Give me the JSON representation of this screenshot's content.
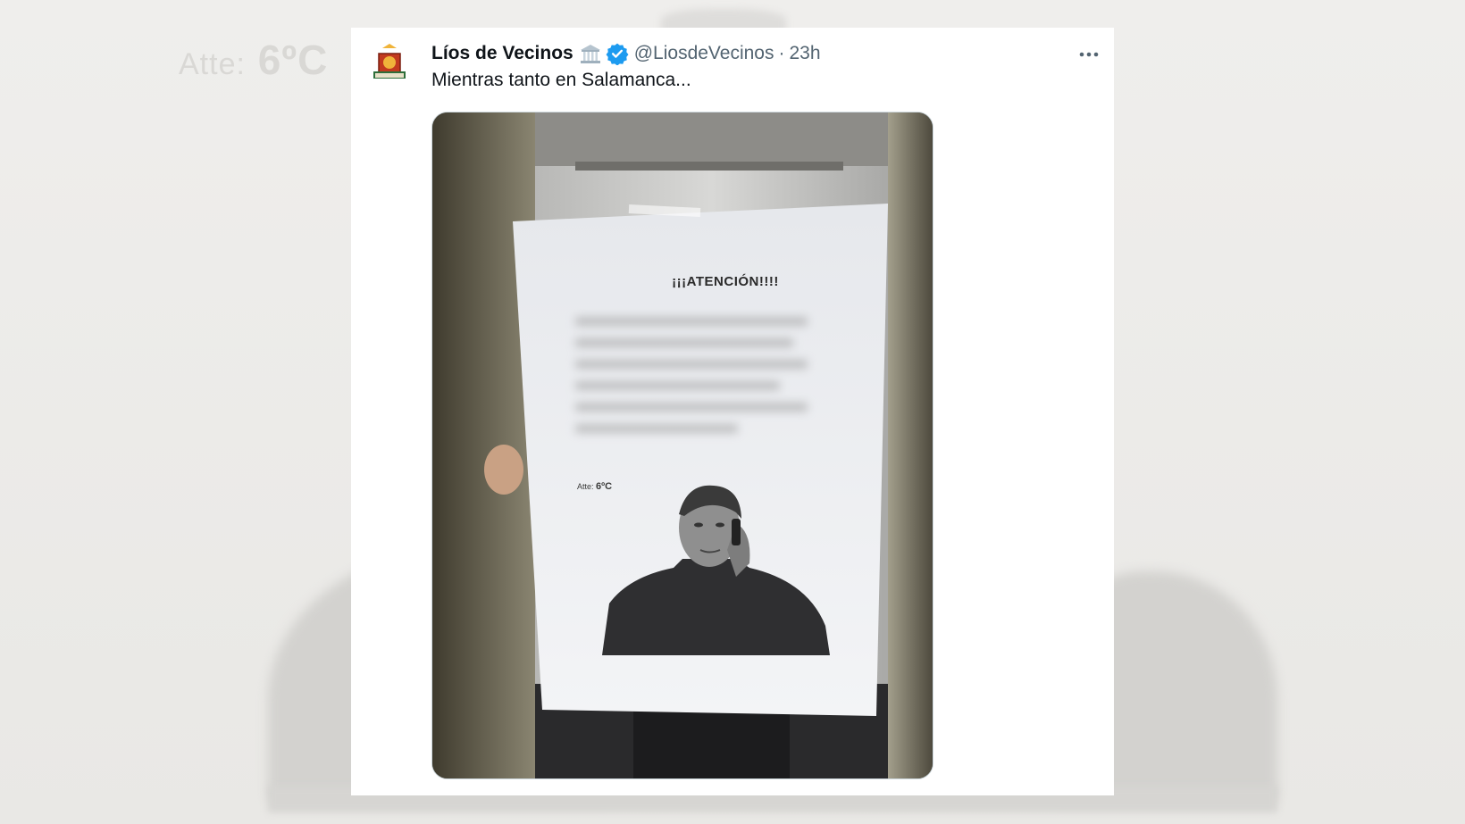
{
  "background": {
    "watermark_prefix": "Atte:",
    "watermark_temp": "6ºC"
  },
  "tweet": {
    "display_name": "Líos de Vecinos",
    "handle": "@LiosdeVecinos",
    "separator": "·",
    "time": "23h",
    "text": "Mientras tanto en Salamanca...",
    "avatar_label": "Líos de Vecinos",
    "more_icon": "more-horizontal-icon",
    "verified_icon": "verified-badge-icon",
    "emoji_icon": "classical-building-emoji-icon"
  },
  "photo": {
    "poster_title": "¡¡¡ATENCIÓN!!!!",
    "sign_prefix": "Atte:",
    "sign_temp": "6ºC"
  },
  "colors": {
    "verified": "#1d9bf0",
    "text_primary": "#0f1419",
    "text_secondary": "#536471"
  }
}
